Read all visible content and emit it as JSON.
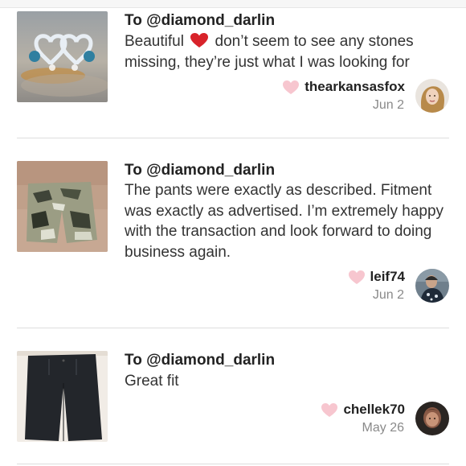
{
  "reviews": [
    {
      "to": "To @diamond_darlin",
      "text_before": "Beautiful",
      "text_after": "don’t seem to see any stones missing, they’re just what I was looking for",
      "inline_icon": "red-heart-emoji",
      "author": "thearkansasfox",
      "date": "Jun 2",
      "product_image": "blue-heart-earrings",
      "avatar": "user-avatar"
    },
    {
      "to": "To @diamond_darlin",
      "text_before": "The pants were exactly as described. Fitment was exactly as advertised. I’m extremely happy with the transaction and look forward to doing business again.",
      "text_after": "",
      "author": "leif74",
      "date": "Jun 2",
      "product_image": "camo-cargo-shorts",
      "avatar": "user-avatar"
    },
    {
      "to": "To @diamond_darlin",
      "text_before": "Great fit",
      "text_after": "",
      "author": "chellek70",
      "date": "May 26",
      "product_image": "black-pants",
      "avatar": "user-avatar"
    }
  ],
  "icons": {
    "author_heart": "heart-icon",
    "author_heart_color": "#f7c6cf",
    "inline_heart_color": "#d8232a"
  }
}
